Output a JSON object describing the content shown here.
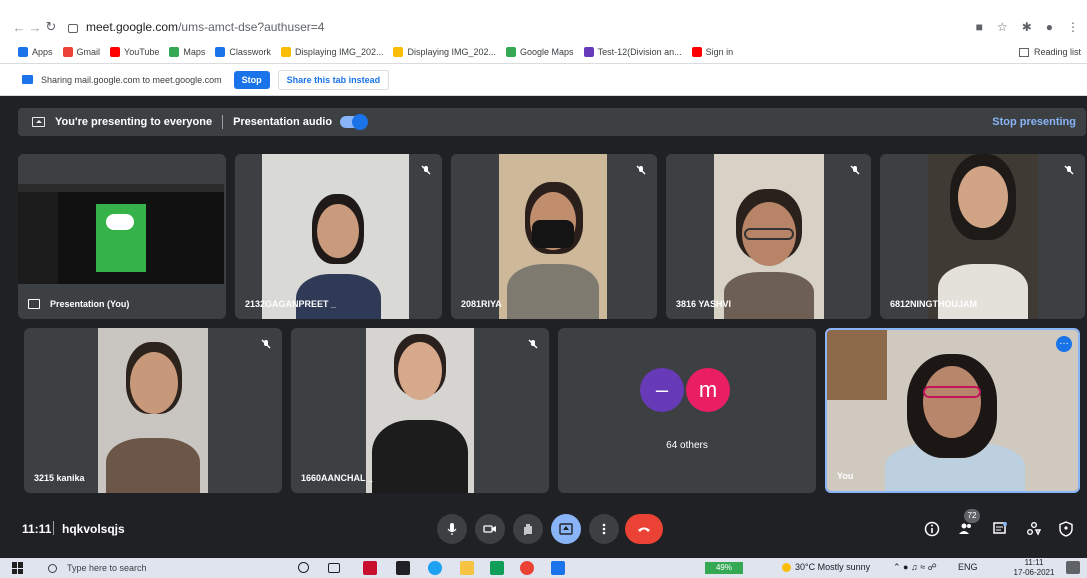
{
  "browser": {
    "url_host": "meet.google.com",
    "url_path": "/ums-amct-dse?authuser=4",
    "bookmarks": [
      {
        "label": "Apps",
        "icon": "apps-grid-icon",
        "color": "#1a73e8"
      },
      {
        "label": "Gmail",
        "icon": "gmail-icon",
        "color": "#ea4335"
      },
      {
        "label": "YouTube",
        "icon": "youtube-icon",
        "color": "#ff0000"
      },
      {
        "label": "Maps",
        "icon": "maps-pin-icon",
        "color": "#34a853"
      },
      {
        "label": "Classwork",
        "icon": "classroom-icon",
        "color": "#1a73e8"
      },
      {
        "label": "Displaying IMG_202...",
        "icon": "photos-icon",
        "color": "#fbbc04"
      },
      {
        "label": "Displaying IMG_202...",
        "icon": "photos-icon",
        "color": "#fbbc04"
      },
      {
        "label": "Google Maps",
        "icon": "maps-pin-icon",
        "color": "#34a853"
      },
      {
        "label": "Test-12(Division an...",
        "icon": "forms-icon",
        "color": "#673ab7"
      },
      {
        "label": "Sign in",
        "icon": "youtube-icon",
        "color": "#ff0000"
      }
    ],
    "reading_list": "Reading list"
  },
  "share_bar": {
    "message": "Sharing mail.google.com to meet.google.com",
    "stop": "Stop",
    "share_tab": "Share this tab instead"
  },
  "present_bar": {
    "title": "You're presenting to everyone",
    "audio": "Presentation audio",
    "stop": "Stop presenting"
  },
  "tiles": {
    "presentation": "Presentation (You)",
    "p1": "2132GAGANPREET _",
    "p2": "2081RIYA",
    "p3": "3816 YASHVI",
    "p4": "6812NINGTHOUJAM",
    "p5": "3215 kanika",
    "p6": "1660AANCHAL _",
    "others_count": "64 others",
    "others_avatar_1": "–",
    "others_avatar_2": "m",
    "you": "You"
  },
  "meet_bar": {
    "time": "11:11",
    "code": "hqkvolsqjs",
    "people_count": "72"
  },
  "taskbar": {
    "search_placeholder": "Type here to search",
    "battery": "49%",
    "weather": "30°C  Mostly sunny",
    "lang": "ENG",
    "time": "11:11",
    "date": "17-06-2021"
  },
  "colors": {
    "meet_bg": "#202124",
    "tile_bg": "#3c4043",
    "accent": "#1a73e8",
    "end_call": "#ea4335",
    "avatar_purple": "#673ab7",
    "avatar_pink": "#e91e63"
  }
}
